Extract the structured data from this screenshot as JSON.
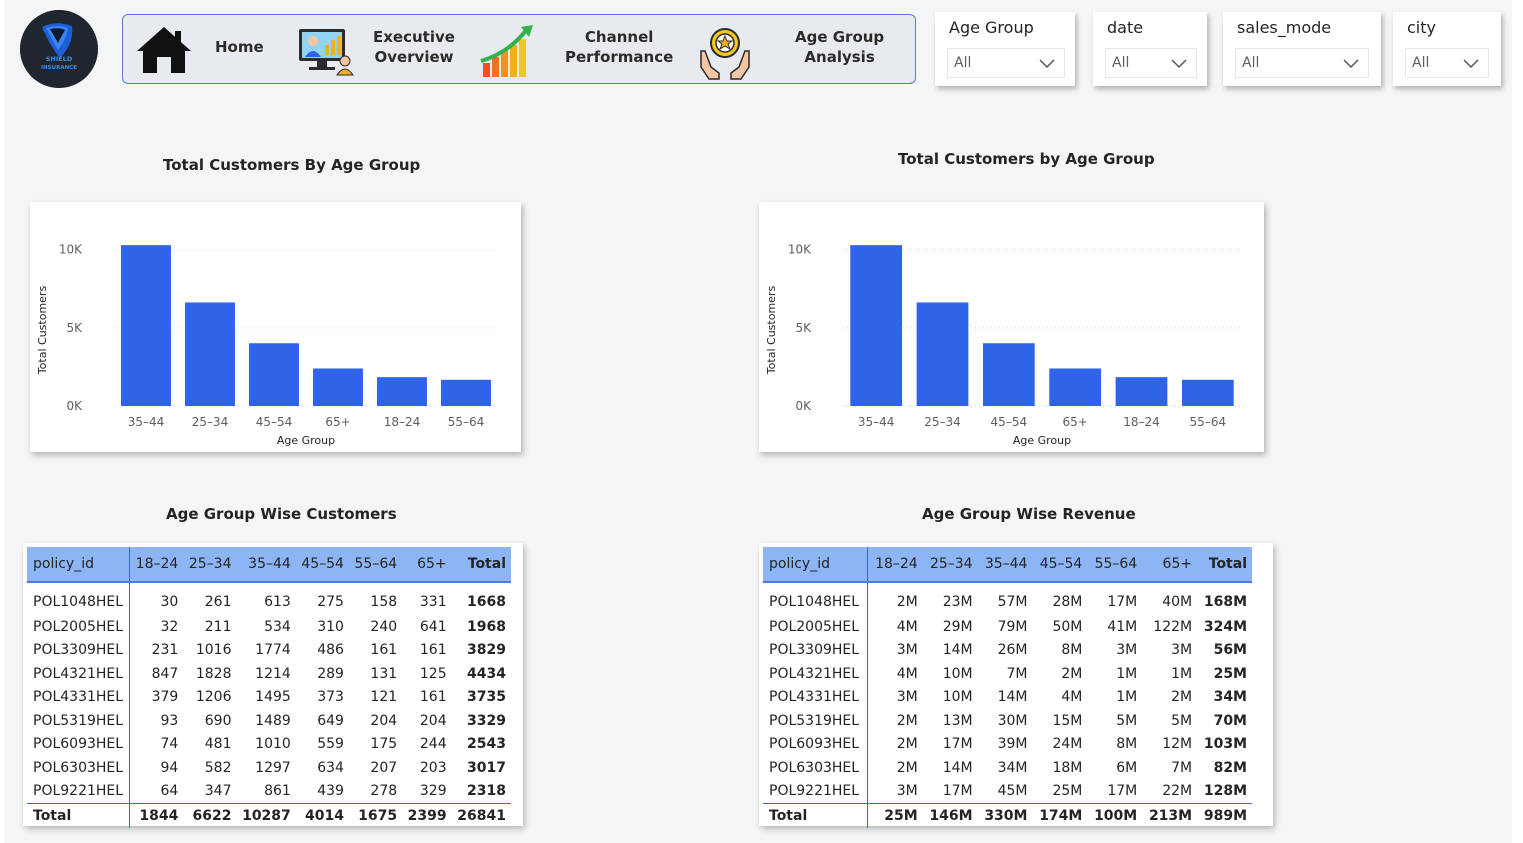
{
  "logo": {
    "line1": "SHIELD",
    "line2": "INSURANCE"
  },
  "nav": {
    "home": "Home",
    "executive": [
      "Executive",
      "Overview"
    ],
    "channel": [
      "Channel",
      "Performance"
    ],
    "age": [
      "Age Group",
      "Analysis"
    ]
  },
  "slicers": [
    {
      "title": "Age Group",
      "value": "All"
    },
    {
      "title": "date",
      "value": "All"
    },
    {
      "title": "sales_mode",
      "value": "All"
    },
    {
      "title": "city",
      "value": "All"
    }
  ],
  "colors": {
    "bar": "#2f63e8",
    "header": "#8db4f4",
    "accent": "#3c69c8"
  },
  "charts": {
    "left_title": "Total Customers By Age Group",
    "right_title": "Total Customers by Age Group"
  },
  "chart_data": [
    {
      "type": "bar",
      "title": "Total Customers By Age Group",
      "xlabel": "Age Group",
      "ylabel": "Total Customers",
      "categories": [
        "35–44",
        "25–34",
        "45–54",
        "65+",
        "18–24",
        "55–64"
      ],
      "values": [
        10287,
        6622,
        4014,
        2399,
        1844,
        1675
      ],
      "yticks": [
        "0K",
        "5K",
        "10K"
      ],
      "ylim": [
        0,
        11000
      ],
      "grid": true
    },
    {
      "type": "bar",
      "title": "Total Customers by Age Group",
      "xlabel": "Age Group",
      "ylabel": "Total Customers",
      "categories": [
        "35–44",
        "25–34",
        "45–54",
        "65+",
        "18–24",
        "55–64"
      ],
      "values": [
        10287,
        6622,
        4014,
        2399,
        1844,
        1675
      ],
      "yticks": [
        "0K",
        "5K",
        "10K"
      ],
      "ylim": [
        0,
        11000
      ],
      "grid": true
    }
  ],
  "table_customers": {
    "title": "Age Group Wise Customers",
    "headers": [
      "policy_id",
      "18–24",
      "25–34",
      "35–44",
      "45–54",
      "55–64",
      "65+",
      "Total"
    ],
    "rows": [
      [
        "POL1048HEL",
        "30",
        "261",
        "613",
        "275",
        "158",
        "331",
        "1668"
      ],
      [
        "POL2005HEL",
        "32",
        "211",
        "534",
        "310",
        "240",
        "641",
        "1968"
      ],
      [
        "POL3309HEL",
        "231",
        "1016",
        "1774",
        "486",
        "161",
        "161",
        "3829"
      ],
      [
        "POL4321HEL",
        "847",
        "1828",
        "1214",
        "289",
        "131",
        "125",
        "4434"
      ],
      [
        "POL4331HEL",
        "379",
        "1206",
        "1495",
        "373",
        "121",
        "161",
        "3735"
      ],
      [
        "POL5319HEL",
        "93",
        "690",
        "1489",
        "649",
        "204",
        "204",
        "3329"
      ],
      [
        "POL6093HEL",
        "74",
        "481",
        "1010",
        "559",
        "175",
        "244",
        "2543"
      ],
      [
        "POL6303HEL",
        "94",
        "582",
        "1297",
        "634",
        "207",
        "203",
        "3017"
      ],
      [
        "POL9221HEL",
        "64",
        "347",
        "861",
        "439",
        "278",
        "329",
        "2318"
      ]
    ],
    "total": [
      "Total",
      "1844",
      "6622",
      "10287",
      "4014",
      "1675",
      "2399",
      "26841"
    ]
  },
  "table_revenue": {
    "title": "Age Group Wise Revenue",
    "headers": [
      "policy_id",
      "18–24",
      "25–34",
      "35–44",
      "45–54",
      "55–64",
      "65+",
      "Total"
    ],
    "rows": [
      [
        "POL1048HEL",
        "2M",
        "23M",
        "57M",
        "28M",
        "17M",
        "40M",
        "168M"
      ],
      [
        "POL2005HEL",
        "4M",
        "29M",
        "79M",
        "50M",
        "41M",
        "122M",
        "324M"
      ],
      [
        "POL3309HEL",
        "3M",
        "14M",
        "26M",
        "8M",
        "3M",
        "3M",
        "56M"
      ],
      [
        "POL4321HEL",
        "4M",
        "10M",
        "7M",
        "2M",
        "1M",
        "1M",
        "25M"
      ],
      [
        "POL4331HEL",
        "3M",
        "10M",
        "14M",
        "4M",
        "1M",
        "2M",
        "34M"
      ],
      [
        "POL5319HEL",
        "2M",
        "13M",
        "30M",
        "15M",
        "5M",
        "5M",
        "70M"
      ],
      [
        "POL6093HEL",
        "2M",
        "17M",
        "39M",
        "24M",
        "8M",
        "12M",
        "103M"
      ],
      [
        "POL6303HEL",
        "2M",
        "14M",
        "34M",
        "18M",
        "6M",
        "7M",
        "82M"
      ],
      [
        "POL9221HEL",
        "3M",
        "17M",
        "45M",
        "25M",
        "17M",
        "22M",
        "128M"
      ]
    ],
    "total": [
      "Total",
      "25M",
      "146M",
      "330M",
      "174M",
      "100M",
      "213M",
      "989M"
    ]
  }
}
